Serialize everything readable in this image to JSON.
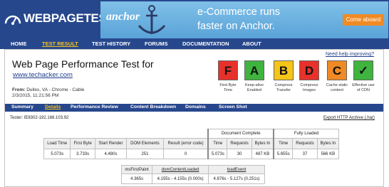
{
  "header": {
    "logo_text": "WEBPAGETEST",
    "ad": {
      "brand": "anchor",
      "headline_line1": "e-Commerce runs",
      "headline_line2": "faster on Anchor.",
      "cta": "Come aboard",
      "bg_color": "#6cb4e4",
      "cta_color": "#f08a24"
    }
  },
  "nav": {
    "items": [
      "HOME",
      "TEST RESULT",
      "TEST HISTORY",
      "FORUMS",
      "DOCUMENTATION",
      "ABOUT"
    ],
    "active": "TEST RESULT"
  },
  "help_link": "Need help improving?",
  "page": {
    "title": "Web Page Performance Test for",
    "url": "www.techacker.com",
    "from_label": "From:",
    "from_value": "Dulles, VA - Chrome - Cable",
    "date": "2/3/2015, 11:21:56 PM"
  },
  "grades": [
    {
      "grade": "F",
      "label": "First Byte Time",
      "color": "#e8312b"
    },
    {
      "grade": "A",
      "label": "Keep-alive Enabled",
      "color": "#3fb43f"
    },
    {
      "grade": "B",
      "label": "Compress Transfer",
      "color": "#f5c518"
    },
    {
      "grade": "D",
      "label": "Compress Images",
      "color": "#e8312b"
    },
    {
      "grade": "C",
      "label": "Cache static content",
      "color": "#f08a24"
    },
    {
      "grade": "✓",
      "label": "Effective use of CDN",
      "color": "#3fb43f"
    }
  ],
  "subnav": {
    "items": [
      "Summary",
      "Details",
      "Performance Review",
      "Content Breakdown",
      "Domains",
      "Screen Shot"
    ],
    "active": "Details"
  },
  "tester": "Tester: IE8302-192.168.103.92",
  "export": "Export HTTP Archive (.har)",
  "results": {
    "groups": {
      "document_complete": "Document Complete",
      "fully_loaded": "Fully Loaded"
    },
    "headers": [
      "Load Time",
      "First Byte",
      "Start Render",
      "DOM Elements",
      "Result (error code)",
      "Time",
      "Requests",
      "Bytes In",
      "Time",
      "Requests",
      "Bytes In"
    ],
    "row": [
      "5.073s",
      "3.733s",
      "4.480s",
      "251",
      "0",
      "5.073s",
      "30",
      "487 KB",
      "5.655s",
      "37",
      "566 KB"
    ]
  },
  "timings": {
    "headers": [
      "msFirstPaint",
      "domContentLoaded",
      "loadEvent"
    ],
    "row": [
      "4.365s",
      "4.155s - 4.155s (0.000s)",
      "4.876s - 5.127s (0.251s)"
    ]
  }
}
